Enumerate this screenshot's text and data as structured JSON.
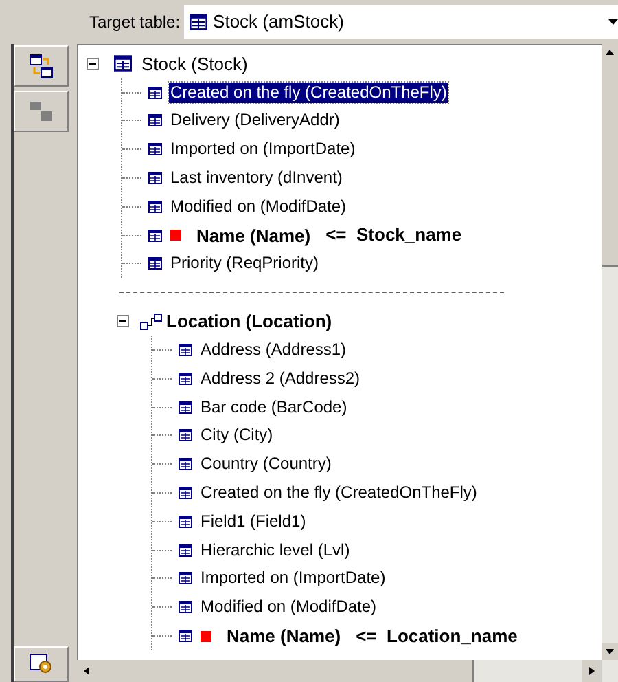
{
  "target_table": {
    "label": "Target table:",
    "value": "Stock (amStock)"
  },
  "tree": [
    {
      "label": "Stock (Stock)",
      "kind": "table",
      "expanded": true,
      "children": [
        {
          "label": "Created on the fly (CreatedOnTheFly)",
          "selected": true,
          "mapped": false
        },
        {
          "label": "Delivery (DeliveryAddr)",
          "selected": false,
          "mapped": false
        },
        {
          "label": "Imported on (ImportDate)",
          "selected": false,
          "mapped": false
        },
        {
          "label": "Last inventory (dInvent)",
          "selected": false,
          "mapped": false
        },
        {
          "label": "Modified on (ModifDate)",
          "selected": false,
          "mapped": false
        },
        {
          "label": "Name (Name)",
          "mapping": "<=  Stock_name",
          "selected": false,
          "mapped": true
        },
        {
          "label": "Priority (ReqPriority)",
          "selected": false,
          "mapped": false
        }
      ]
    },
    {
      "label": "Location (Location)",
      "kind": "link",
      "expanded": true,
      "children": [
        {
          "label": "Address (Address1)",
          "selected": false,
          "mapped": false
        },
        {
          "label": "Address 2 (Address2)",
          "selected": false,
          "mapped": false
        },
        {
          "label": "Bar code (BarCode)",
          "selected": false,
          "mapped": false
        },
        {
          "label": "City (City)",
          "selected": false,
          "mapped": false
        },
        {
          "label": "Country (Country)",
          "selected": false,
          "mapped": false
        },
        {
          "label": "Created on the fly (CreatedOnTheFly)",
          "selected": false,
          "mapped": false
        },
        {
          "label": "Field1 (Field1)",
          "selected": false,
          "mapped": false
        },
        {
          "label": "Hierarchic level (Lvl)",
          "selected": false,
          "mapped": false
        },
        {
          "label": "Imported on (ImportDate)",
          "selected": false,
          "mapped": false
        },
        {
          "label": "Modified on (ModifDate)",
          "selected": false,
          "mapped": false
        },
        {
          "label": "Name (Name)",
          "mapping": "<=  Location_name",
          "selected": false,
          "mapped": true
        }
      ]
    }
  ]
}
